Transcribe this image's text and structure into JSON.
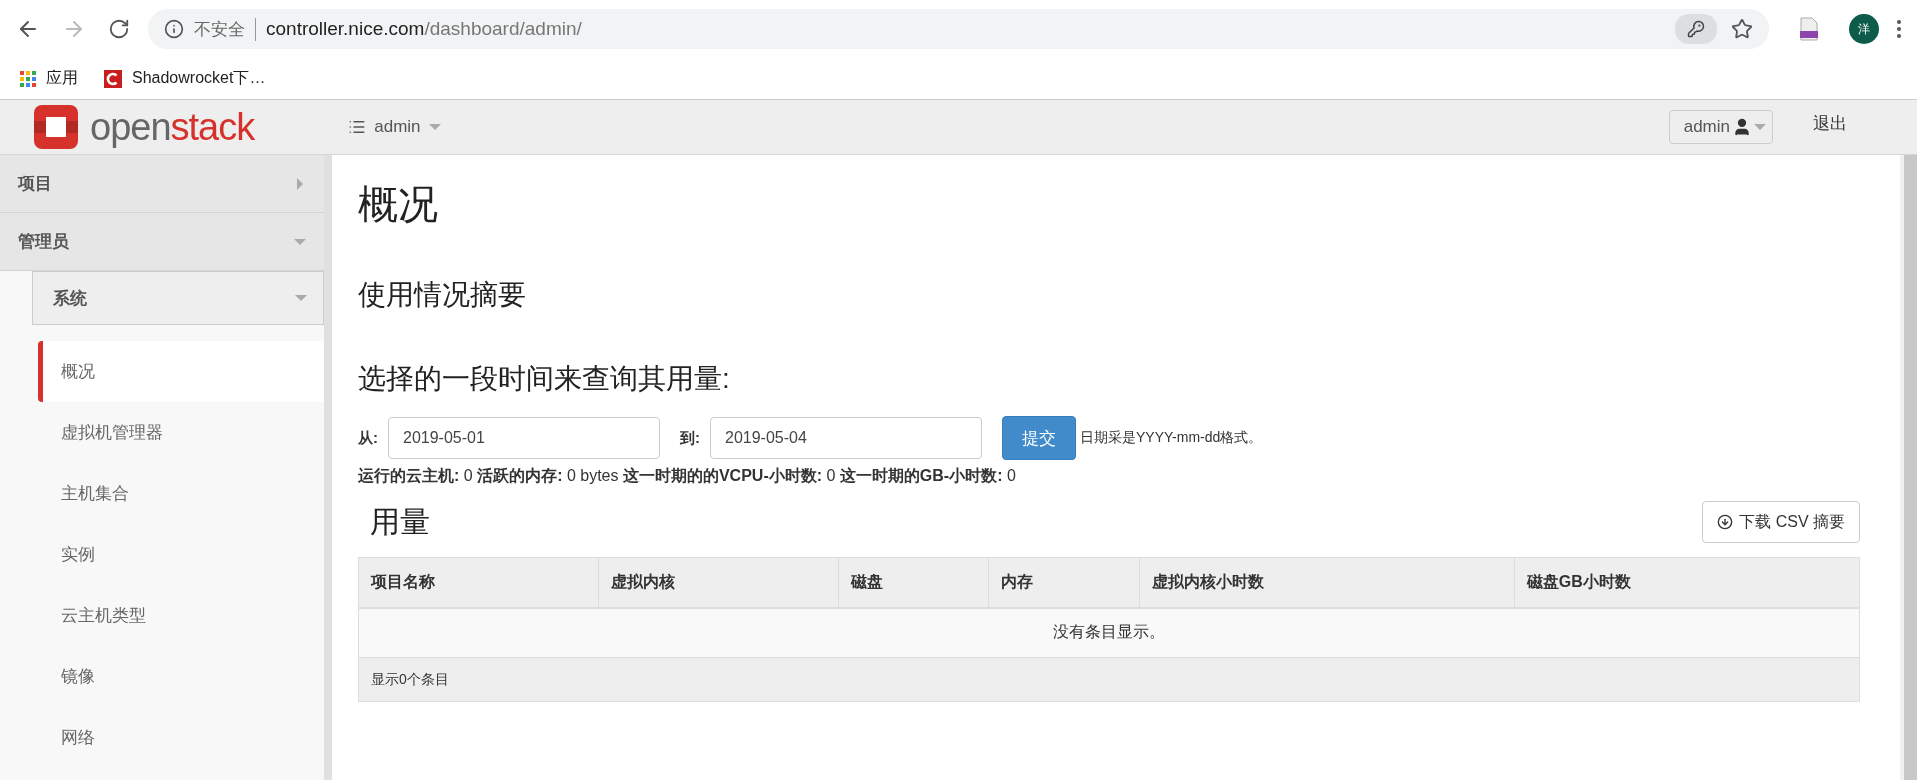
{
  "browser": {
    "security_label": "不安全",
    "url_host": "controller.nice.com",
    "url_path": "/dashboard/admin/",
    "avatar": "洋",
    "bookmarks": [
      {
        "kind": "apps",
        "label": "应用"
      },
      {
        "kind": "site",
        "label": "Shadowrocket下…"
      }
    ]
  },
  "header": {
    "logo": {
      "prefix": "open",
      "suffix": "stack"
    },
    "project_menu": "admin",
    "user_menu": "admin",
    "logout": "退出"
  },
  "sidebar": [
    {
      "label": "项目",
      "expanded": false
    },
    {
      "label": "管理员",
      "expanded": true,
      "children": [
        {
          "label": "系统",
          "expanded": true,
          "children": [
            {
              "label": "概况",
              "selected": true
            },
            {
              "label": "虚拟机管理器",
              "selected": false
            },
            {
              "label": "主机集合",
              "selected": false
            },
            {
              "label": "实例",
              "selected": false
            },
            {
              "label": "云主机类型",
              "selected": false
            },
            {
              "label": "镜像",
              "selected": false
            },
            {
              "label": "网络",
              "selected": false
            }
          ]
        }
      ]
    }
  ],
  "page": {
    "title": "概况",
    "summary_title": "使用情况摘要",
    "period_title": "选择的一段时间来查询其用量:",
    "form": {
      "from_label": "从:",
      "from_value": "2019-05-01",
      "to_label": "到:",
      "to_value": "2019-05-04",
      "submit": "提交",
      "hint": "日期采是YYYY-mm-dd格式。"
    },
    "stats": "**运行的云主机:** 0 **活跃的内存:** 0 bytes **这一时期的的VCPU-小时数:** 0 **这一时期的GB-小时数:** 0",
    "usage_title": "用量",
    "csv_button": "下载 CSV 摘要",
    "table": {
      "columns": [
        "项目名称",
        "虚拟内核",
        "磁盘",
        "内存",
        "虚拟内核小时数",
        "磁盘GB小时数"
      ],
      "empty_message": "没有条目显示。",
      "footer": "显示0个条目"
    }
  }
}
